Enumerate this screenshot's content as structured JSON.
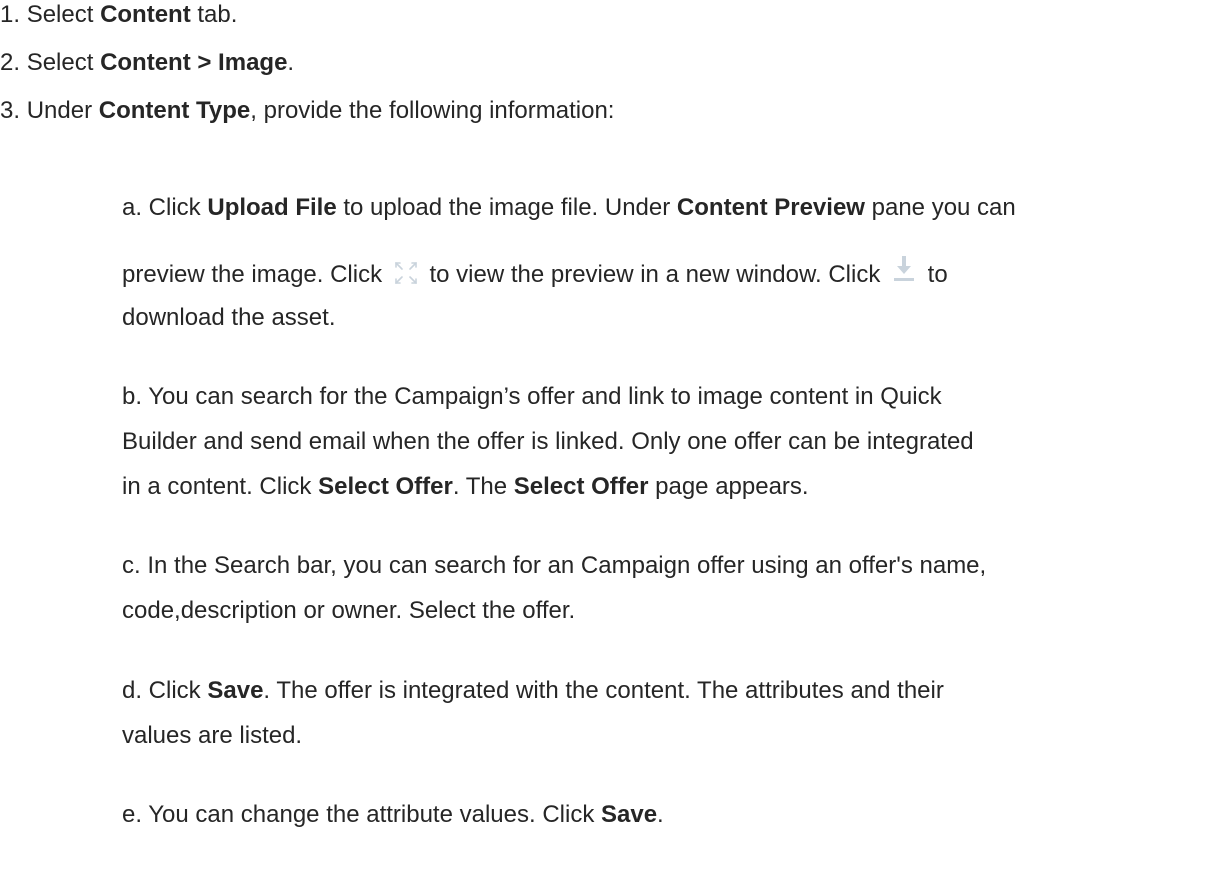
{
  "steps": [
    {
      "num": "1. ",
      "pre": "Select ",
      "bold": "Content",
      "post": " tab."
    },
    {
      "num": "2. ",
      "pre": "Select ",
      "bold": "Content > Image",
      "post": "."
    },
    {
      "num": "3. ",
      "pre": "Under ",
      "bold": "Content Type",
      "post": ", provide the following information:"
    }
  ],
  "substeps": {
    "a": {
      "line1_pre": "a. Click ",
      "line1_bold1": "Upload File",
      "line1_mid": " to upload the image file. Under ",
      "line1_bold2": "Content Preview",
      "line1_post": " pane you can",
      "line2_pre": "preview the image. Click",
      "line2_mid": "to view the preview in a new window. Click",
      "line2_post": "to",
      "line3": "download the asset.",
      "icons": [
        "expand-icon",
        "download-icon"
      ]
    },
    "b": {
      "line1": "b. You can search for the Campaign’s offer and link to image content in Quick",
      "line2": "Builder and send email when the offer is linked. Only one offer can be integrated",
      "line3_pre": "in a content. Click ",
      "line3_bold1": "Select Offer",
      "line3_mid": ". The ",
      "line3_bold2": "Select Offer",
      "line3_post": " page appears."
    },
    "c": {
      "line1": "c. In the Search bar, you can search for an Campaign offer using an offer's name,",
      "line2": "code,description or owner. Select the offer."
    },
    "d": {
      "line1_pre": "d. Click ",
      "line1_bold": "Save",
      "line1_post": ". The offer is integrated with the content. The attributes and their",
      "line2": "values are listed."
    },
    "e": {
      "line1_pre": "e. You can change the attribute values. Click ",
      "line1_bold": "Save",
      "line1_post": "."
    }
  }
}
